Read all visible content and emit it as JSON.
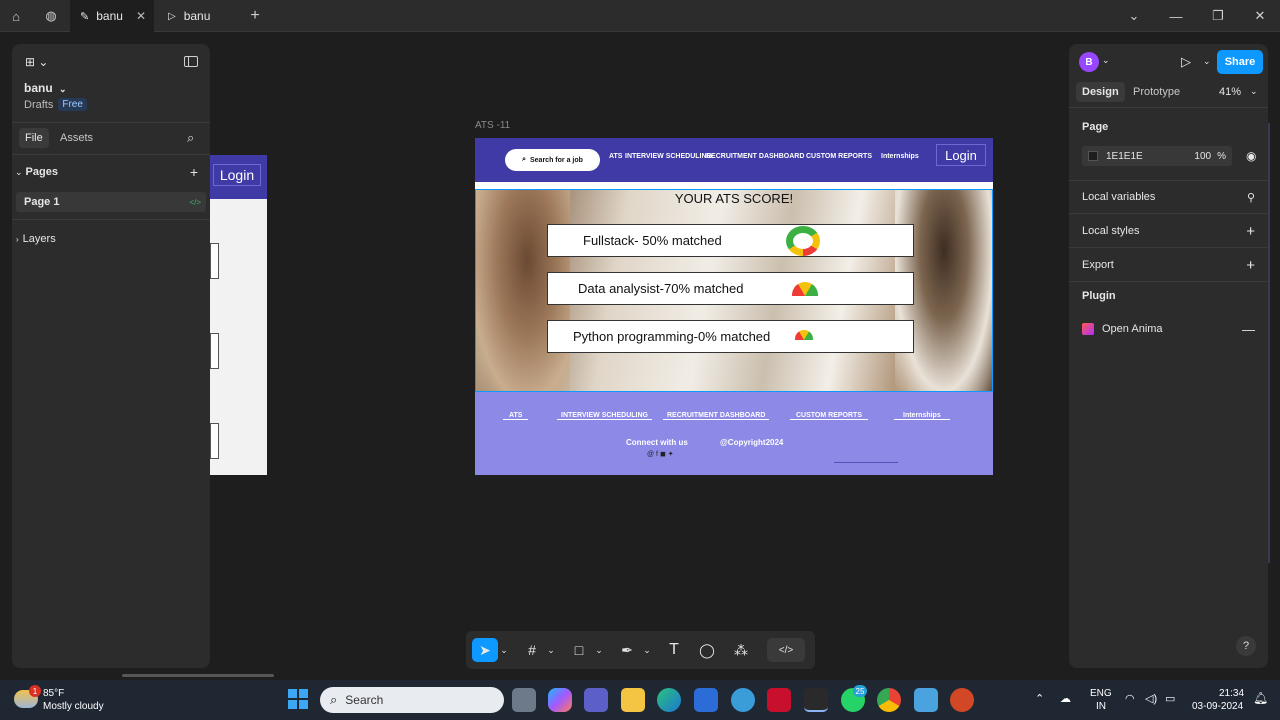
{
  "browser": {
    "tabs": [
      {
        "label": "banu"
      },
      {
        "label": "banu"
      }
    ]
  },
  "left_panel": {
    "file_name": "banu",
    "drafts": "Drafts",
    "plan": "Free",
    "tabs": {
      "file": "File",
      "assets": "Assets"
    },
    "pages_label": "Pages",
    "page_item": "Page 1",
    "layers_label": "Layers"
  },
  "canvas": {
    "frame_label": "ATS -11",
    "side_login": "Login",
    "navbar": {
      "search": "Search for a job",
      "links": [
        "ATS",
        "INTERVIEW SCHEDULING",
        "RECRUITMENT DASHBOARD",
        "CUSTOM REPORTS",
        "Internships"
      ],
      "login": "Login"
    },
    "hero": {
      "title": "YOUR ATS SCORE!",
      "scores": [
        {
          "text": "Fullstack- 50% matched",
          "value": 50
        },
        {
          "text": "Data analysist-70% matched",
          "value": 70
        },
        {
          "text": "Python programming-0% matched",
          "value": 0
        }
      ]
    },
    "footer": {
      "links": [
        "ATS",
        "INTERVIEW SCHEDULING",
        "RECRUITMENT DASHBOARD",
        "CUSTOM REPORTS",
        "Internships"
      ],
      "connect": "Connect with us",
      "copyright": "@Copyright2024"
    }
  },
  "right_panel": {
    "avatar": "B",
    "share": "Share",
    "tabs": {
      "design": "Design",
      "prototype": "Prototype"
    },
    "zoom": "41%",
    "page_label": "Page",
    "bg_color": "1E1E1E",
    "opacity": "100",
    "opacity_unit": "%",
    "local_variables": "Local variables",
    "local_styles": "Local styles",
    "export": "Export",
    "plugin": "Plugin",
    "plugin_item": "Open Anima"
  },
  "taskbar": {
    "weather_temp": "85°F",
    "weather_desc": "Mostly cloudy",
    "weather_badge": "1",
    "search": "Search",
    "whatsapp_badge": "25",
    "lang": "ENG",
    "region": "IN",
    "time": "21:34",
    "date": "03-09-2024"
  },
  "colors": {
    "accent": "#0d99ff",
    "navbar": "#3f3aa5",
    "footer": "#8c89e7",
    "avatar": "#9747ff"
  }
}
